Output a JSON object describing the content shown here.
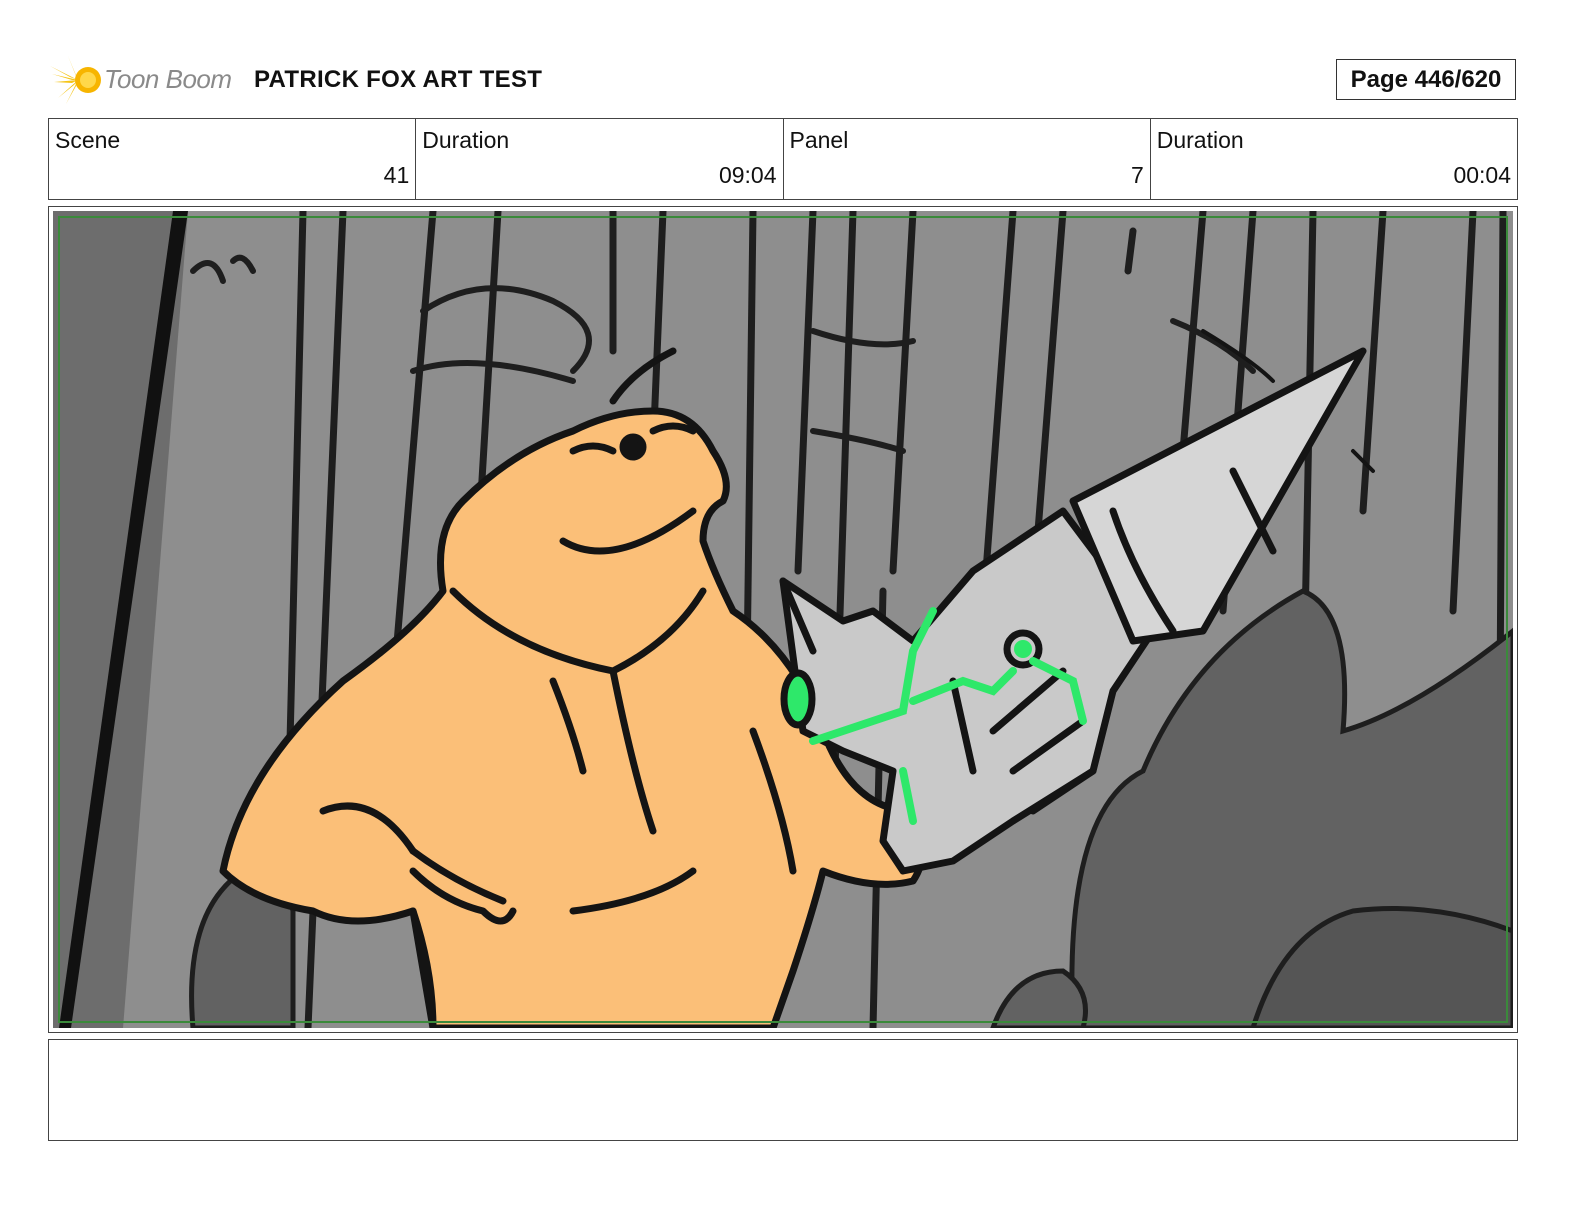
{
  "header": {
    "logo_text": "Toon Boom",
    "project_title": "PATRICK FOX ART TEST",
    "page_label": "Page 446/620"
  },
  "info": {
    "scene_label": "Scene",
    "scene_value": "41",
    "scene_duration_label": "Duration",
    "scene_duration_value": "09:04",
    "panel_label": "Panel",
    "panel_value": "7",
    "panel_duration_label": "Duration",
    "panel_duration_value": "00:04"
  },
  "panel": {
    "image_subject": "character-in-orange-hoodie-holding-robotic-drill-arm",
    "colors": {
      "background": "#8e8e8e",
      "character": "#fbbf78",
      "drill": "#c9c9c9",
      "glow": "#2ee86a",
      "ink": "#141414",
      "frame": "#3b8a3b"
    }
  },
  "notes": {
    "text": ""
  }
}
